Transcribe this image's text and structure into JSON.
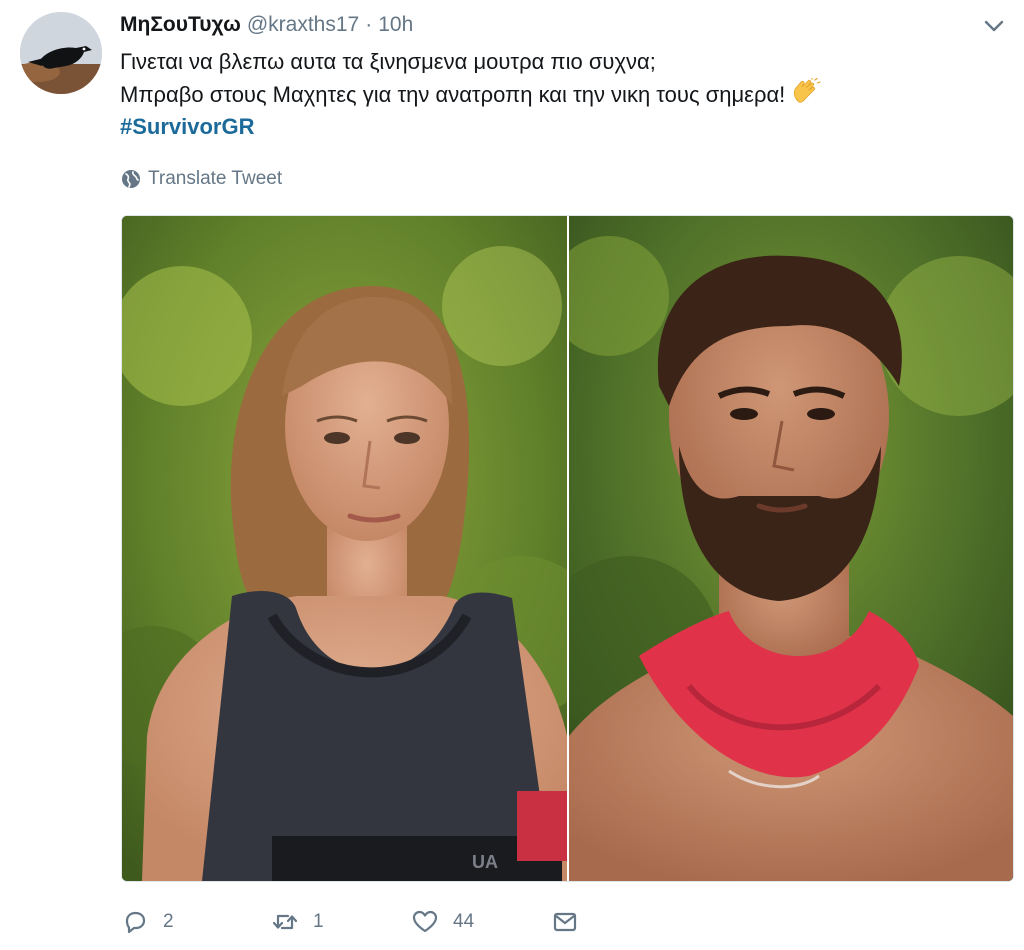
{
  "tweet": {
    "author_name": "ΜηΣουΤυχω",
    "handle": "@kraxths17",
    "separator": "·",
    "time": "10h",
    "text_line1": "Γινεται να βλεπω αυτα τα ξινησμενα μουτρα πιο συχνα;",
    "text_line2": "Μπραβο στους Μαχητες για την ανατροπη και την νικη τους σημερα!",
    "hashtag": "#SurvivorGR",
    "translate_label": "Translate Tweet",
    "brand_text_shirt": "UA"
  },
  "actions": {
    "reply_count": "2",
    "retweet_count": "1",
    "like_count": "44"
  },
  "icons": {
    "caret": "chevron-down-icon",
    "globe": "globe-icon",
    "reply": "reply-icon",
    "retweet": "retweet-icon",
    "like": "heart-icon",
    "message": "envelope-icon",
    "emoji": "clapping-hands-icon"
  },
  "colors": {
    "link": "#1b6a99",
    "muted": "#657786",
    "text": "#14171a",
    "bandana": "#e0334a"
  }
}
